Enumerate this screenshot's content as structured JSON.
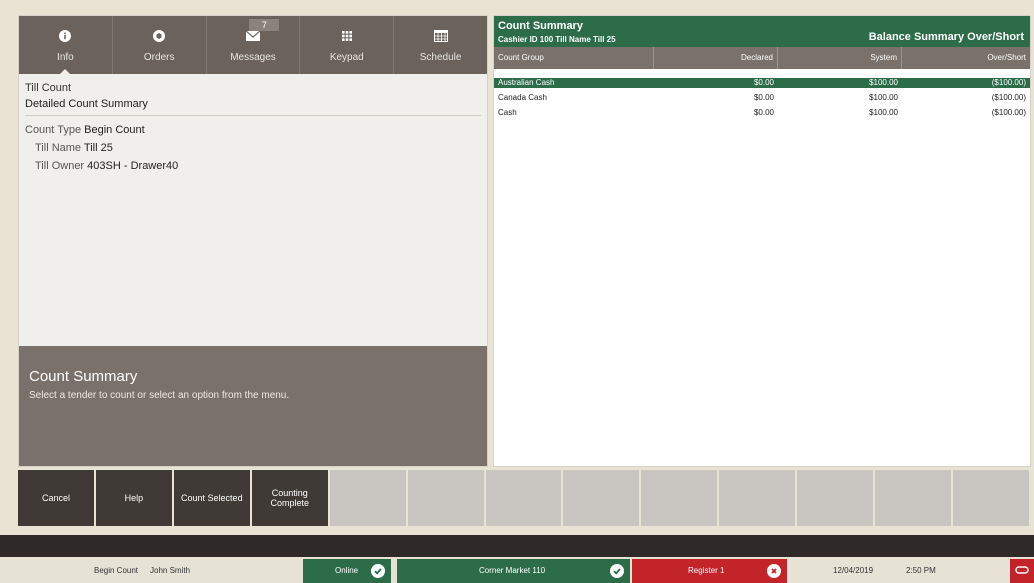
{
  "nav": {
    "tabs": [
      {
        "label": "Info",
        "icon": "info-icon"
      },
      {
        "label": "Orders",
        "icon": "orders-icon"
      },
      {
        "label": "Messages",
        "icon": "messages-icon",
        "badge": "7"
      },
      {
        "label": "Keypad",
        "icon": "keypad-icon"
      },
      {
        "label": "Schedule",
        "icon": "schedule-icon"
      }
    ]
  },
  "left": {
    "till_count_title": "Till Count",
    "detailed_title": "Detailed Count Summary",
    "count_type_label": "Count Type",
    "count_type_value": "Begin Count",
    "till_name_label": "Till Name",
    "till_name_value": "Till 25",
    "till_owner_label": "Till Owner",
    "till_owner_value": "403SH - Drawer40"
  },
  "summary_box": {
    "title": "Count Summary",
    "message": "Select a tender to count or select an option from the menu."
  },
  "right": {
    "title": "Count Summary",
    "subtitle": "Cashier ID 100 Till Name Till 25",
    "right_title": "Balance Summary Over/Short",
    "columns": [
      "Count Group",
      "Declared",
      "System",
      "Over/Short"
    ],
    "rows": [
      {
        "group": "Australian Cash",
        "declared": "$0.00",
        "system": "$100.00",
        "over_short": "($100.00)",
        "selected": true
      },
      {
        "group": "Canada Cash",
        "declared": "$0.00",
        "system": "$100.00",
        "over_short": "($100.00)",
        "selected": false
      },
      {
        "group": "Cash",
        "declared": "$0.00",
        "system": "$100.00",
        "over_short": "($100.00)",
        "selected": false
      }
    ]
  },
  "actions": {
    "cancel": "Cancel",
    "help": "Help",
    "count_selected": "Count Selected",
    "counting_complete_1": "Counting",
    "counting_complete_2": "Complete"
  },
  "status": {
    "mode": "Begin Count",
    "user": "John Smith",
    "online": "Online",
    "store": "Corner Market 110",
    "register": "Register 1",
    "date": "12/04/2019",
    "time": "2:50 PM"
  },
  "colors": {
    "accent_green": "#2c6c48",
    "alert_red": "#c2242a",
    "nav_gray": "#6b625c"
  }
}
